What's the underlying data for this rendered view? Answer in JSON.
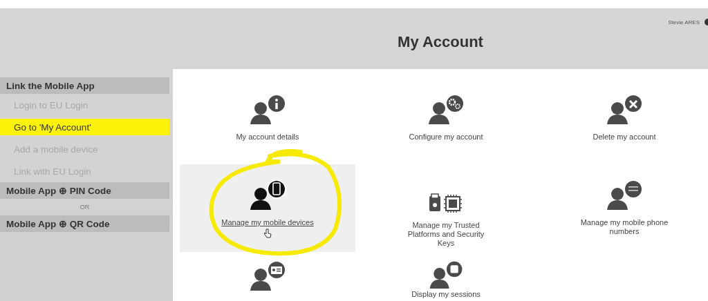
{
  "header": {
    "title": "My Account",
    "user": "Stevie ARES"
  },
  "sidebar": {
    "items": [
      {
        "kind": "header",
        "label": "Link the Mobile App"
      },
      {
        "kind": "step",
        "label": "Login to EU Login",
        "selected": false
      },
      {
        "kind": "step",
        "label": "Go to 'My Account'",
        "selected": true
      },
      {
        "kind": "step",
        "label": "Add a mobile device",
        "selected": false
      },
      {
        "kind": "step",
        "label": "Link with EU Login",
        "selected": false
      },
      {
        "kind": "header",
        "label": "Mobile App ⊕ PIN Code"
      },
      {
        "kind": "separator",
        "label": "OR"
      },
      {
        "kind": "header",
        "label": "Mobile App ⊕ QR Code"
      }
    ]
  },
  "tiles": [
    {
      "kind": "info",
      "label": "My account details",
      "selected": false
    },
    {
      "kind": "gears",
      "label": "Configure my account",
      "selected": false
    },
    {
      "kind": "cross",
      "label": "Delete my account",
      "selected": false
    },
    {
      "kind": "phone",
      "label": "Manage my mobile devices",
      "selected": true
    },
    {
      "kind": "keys",
      "label": "Manage my Trusted Platforms and Security Keys",
      "selected": false
    },
    {
      "kind": "numbers",
      "label": "Manage my mobile phone numbers",
      "selected": false
    },
    {
      "kind": "card",
      "selected": false
    },
    {
      "kind": "sessions",
      "label": "Display my sessions",
      "selected": false
    }
  ]
}
